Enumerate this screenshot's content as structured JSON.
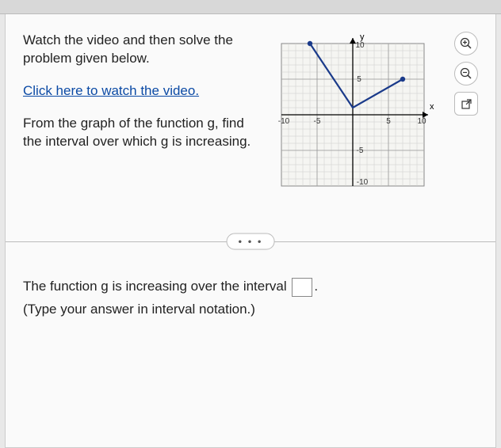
{
  "text": {
    "intro": "Watch the video and then solve the problem given below.",
    "link": "Click here to watch the video.",
    "prompt": "From the graph of the function g, find the interval over which g is increasing."
  },
  "answer": {
    "line_before": "The function g is increasing over the interval ",
    "line_after": ".",
    "note": "(Type your answer in interval notation.)"
  },
  "divider_dots": "• • •",
  "chart_data": {
    "type": "line",
    "xlabel": "x",
    "ylabel": "y",
    "xlim": [
      -10,
      10
    ],
    "ylim": [
      -10,
      10
    ],
    "x_ticks": [
      -10,
      -5,
      5,
      10
    ],
    "y_ticks": [
      -10,
      -5,
      5,
      10
    ],
    "series": [
      {
        "name": "g",
        "points": [
          [
            -6,
            10
          ],
          [
            0,
            1
          ],
          [
            7,
            5
          ]
        ]
      }
    ],
    "marked_points": [
      [
        -6,
        10
      ],
      [
        7,
        5
      ]
    ]
  },
  "tools": {
    "zoom_in": "zoom-in",
    "zoom_out": "zoom-out",
    "open": "open-external"
  }
}
